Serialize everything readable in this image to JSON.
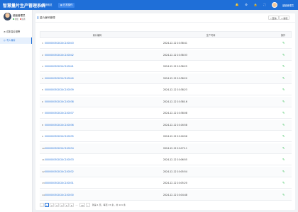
{
  "app": {
    "title": "智慧量片生产管理系统"
  },
  "top_tabs": [
    {
      "label": "系统概览",
      "icon": "home-icon",
      "active": false
    },
    {
      "label": "日常操作",
      "icon": "grid-icon",
      "active": true
    }
  ],
  "top_user": {
    "name": "超级管理员"
  },
  "profile": {
    "name": "超级管理员",
    "status_online": "在线",
    "status_exit": "注销"
  },
  "sidebar": {
    "items": [
      {
        "label": "成本量片报警",
        "icon": "alarm-icon",
        "active": false
      },
      {
        "label": "写入量片",
        "icon": "write-icon",
        "active": true
      }
    ]
  },
  "panel": {
    "title": "量片编号管理",
    "buttons": [
      {
        "label": "查询",
        "icon": "search-icon"
      },
      {
        "label": "新增",
        "icon": "plus-icon"
      }
    ]
  },
  "table": {
    "columns": [
      "量片编码",
      "生产时间",
      "操作"
    ],
    "rows": [
      {
        "index": "1",
        "code": "0000000302024C100043",
        "time": "2024-12-12 10:38:41"
      },
      {
        "index": "2",
        "code": "0000000302024C100042",
        "time": "2024-12-12 10:38:33"
      },
      {
        "index": "3",
        "code": "0000000302024C100041",
        "time": "2024-12-12 10:38:25"
      },
      {
        "index": "4",
        "code": "0000000302024C100040",
        "time": "2024-12-12 10:38:20"
      },
      {
        "index": "5",
        "code": "0000000302024C100039",
        "time": "2024-12-12 10:38:23"
      },
      {
        "index": "6",
        "code": "0000000302024C100038",
        "time": "2024-12-12 10:38:16"
      },
      {
        "index": "7",
        "code": "0000000302024C100037",
        "time": "2024-12-12 10:38:08"
      },
      {
        "index": "8",
        "code": "0000000302024C100036",
        "time": "2024-12-12 10:16:58"
      },
      {
        "index": "9",
        "code": "0000000302024C100035",
        "time": "2024-12-12 10:16:56"
      },
      {
        "index": "10",
        "code": "0000000302024C100034",
        "time": "2024-12-12 10:07:11"
      },
      {
        "index": "11",
        "code": "0000000302024C100033",
        "time": "2024-12-12 10:06:55"
      },
      {
        "index": "12",
        "code": "0000000302024C100032",
        "time": "2024-12-12 10:05:54"
      },
      {
        "index": "13",
        "code": "0000000302024C100031",
        "time": "2024-12-12 10:05:20"
      },
      {
        "index": "14",
        "code": "0000000302024C100030",
        "time": "2024-12-12 10:04:48"
      }
    ]
  },
  "pagination": {
    "prev": "‹",
    "pages": [
      "1",
      "2",
      "3",
      "4",
      "5",
      "6"
    ],
    "ellipsis": "…",
    "last": "10",
    "next": "›",
    "info": "到第 1 页，每页 15 条，共 141 条"
  },
  "colors": {
    "primary": "#1f6fd8",
    "edit": "#2fbf52"
  }
}
